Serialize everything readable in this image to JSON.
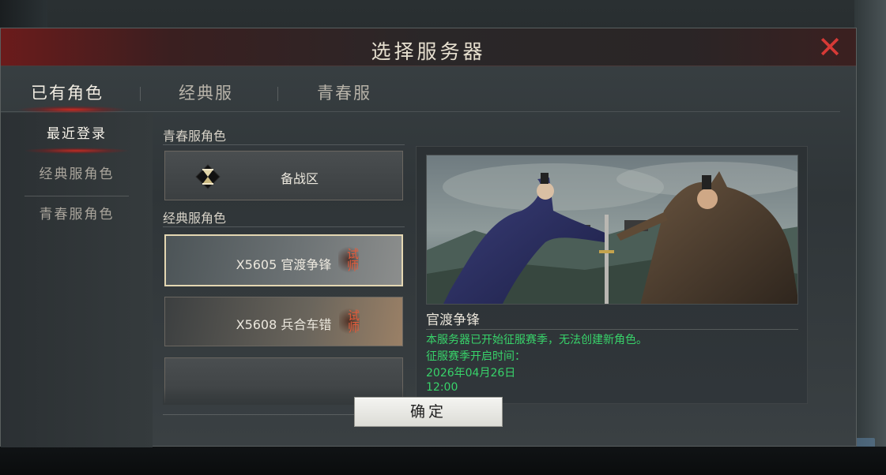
{
  "dialog": {
    "title": "选择服务器",
    "close_icon": "close-x-icon"
  },
  "tabs": [
    {
      "label": "已有角色",
      "active": true
    },
    {
      "label": "经典服",
      "active": false
    },
    {
      "label": "青春服",
      "active": false
    }
  ],
  "sidebar": {
    "items": [
      {
        "label": "最近登录",
        "active": true
      },
      {
        "label": "经典服角色",
        "active": false
      },
      {
        "label": "青春服角色",
        "active": false
      }
    ]
  },
  "server_list": {
    "groups": [
      {
        "label": "青春服角色",
        "servers": [
          {
            "name": "备战区",
            "icon": "hourglass-icon"
          }
        ]
      },
      {
        "label": "经典服角色",
        "servers": [
          {
            "name": "X5605 官渡争锋",
            "badge": "试师",
            "selected": true
          },
          {
            "name": "X5608 兵合车错",
            "badge": "试师",
            "selected": false
          }
        ]
      }
    ]
  },
  "detail": {
    "server_name": "官渡争锋",
    "lines": [
      "本服务器已开始征服赛季，无法创建新角色。",
      "征服赛季开启时间：",
      "2026年04月26日",
      "12:00"
    ],
    "info_color": "#38d36a"
  },
  "confirm_label": "确定",
  "colors": {
    "accent_red": "#d63a36",
    "selected_border": "#e4d7b2"
  }
}
